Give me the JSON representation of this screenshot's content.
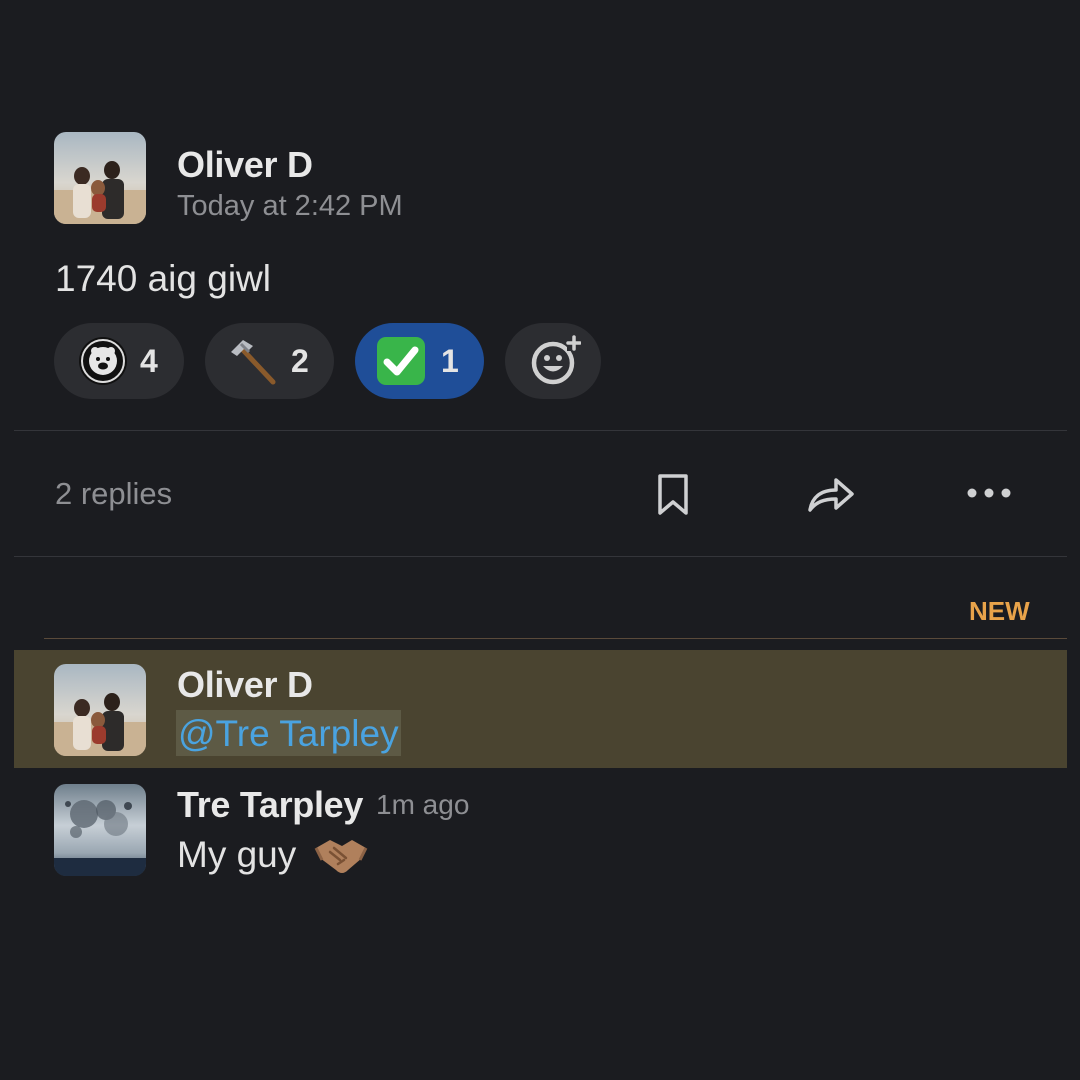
{
  "parent_message": {
    "author": "Oliver D",
    "timestamp": "Today at 2:42 PM",
    "text": "1740 aig giwl",
    "reactions": [
      {
        "icon": "bear-badge-icon",
        "count": "4",
        "active": false
      },
      {
        "icon": "hammer-icon",
        "count": "2",
        "active": false
      },
      {
        "icon": "check-mark-button-icon",
        "count": "1",
        "active": true
      }
    ],
    "add_reaction_icon": "add-reaction-icon"
  },
  "thread_bar": {
    "replies_label": "2 replies",
    "icons": [
      "bookmark-icon",
      "share-icon",
      "more-icon"
    ]
  },
  "new_divider": {
    "label": "NEW",
    "color": "#e8a34a"
  },
  "replies": [
    {
      "author": "Oliver D",
      "mention": "@Tre Tarpley",
      "highlight_color": "#4a4430"
    },
    {
      "author": "Tre Tarpley",
      "time_ago": "1m ago",
      "text": "My guy",
      "emoji": "handshake-icon"
    }
  ],
  "colors": {
    "background": "#1b1c20",
    "reaction_bg": "#2c2d31",
    "active_reaction_bg": "#1f4e98",
    "mention_color": "#4aa3e0"
  }
}
